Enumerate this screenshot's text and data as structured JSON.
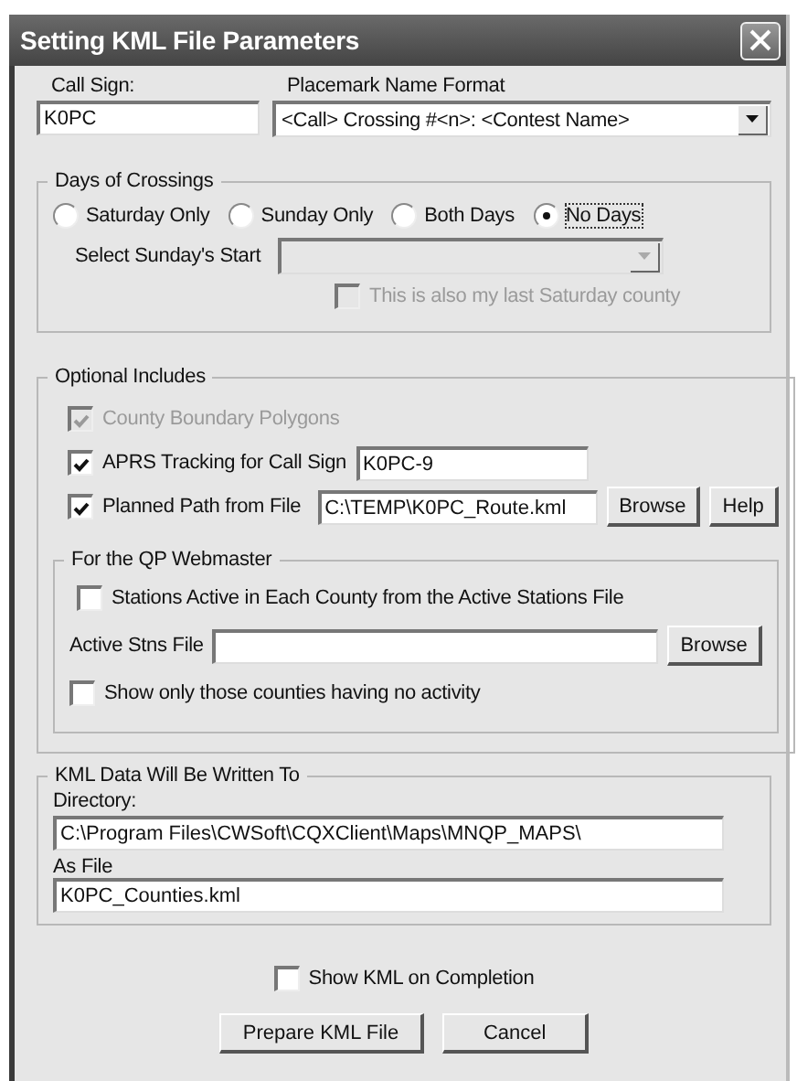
{
  "window": {
    "title": "Setting KML File Parameters"
  },
  "call_sign": {
    "label": "Call Sign:",
    "value": "K0PC"
  },
  "placemark_name_format": {
    "label": "Placemark Name Format",
    "value": "<Call> Crossing #<n>: <Contest Name>"
  },
  "days_of_crossings": {
    "title": "Days of Crossings",
    "options": [
      {
        "label": "Saturday Only",
        "selected": false
      },
      {
        "label": "Sunday Only",
        "selected": false
      },
      {
        "label": "Both Days",
        "selected": false
      },
      {
        "label": "No Days",
        "selected": true
      }
    ],
    "sunday_start": {
      "label": "Select Sunday's Start",
      "disabled": true
    },
    "last_saturday_county": {
      "label": "This is also my last Saturday county",
      "checked": false,
      "disabled": true
    }
  },
  "optional_includes": {
    "title": "Optional Includes",
    "items": [
      {
        "kind": "checkbox",
        "label": "County Boundary Polygons",
        "checked": true,
        "disabled": true
      },
      {
        "kind": "text",
        "label": "APRS Tracking for Call Sign",
        "checked": true,
        "disabled": false,
        "value": "K0PC-9"
      },
      {
        "kind": "file",
        "label": "Planned Path from File",
        "checked": true,
        "disabled": false,
        "value": "C:\\TEMP\\K0PC_Route.kml",
        "buttons": [
          "Browse",
          "Help"
        ]
      }
    ],
    "webmaster": {
      "title": "For the QP Webmaster",
      "stations_active": {
        "label": "Stations Active in Each County from the Active Stations File",
        "checked": false
      },
      "active_stns_file": {
        "label": "Active Stns File",
        "button": "Browse"
      },
      "no_activity": {
        "label": "Show only those counties having no activity",
        "checked": false
      }
    }
  },
  "output": {
    "title": "KML Data Will Be Written To",
    "directory": {
      "label": "Directory:",
      "value": "C:\\Program Files\\CWSoft\\CQXClient\\Maps\\MNQP_MAPS\\"
    },
    "file": {
      "label": "As File",
      "value": "K0PC_Counties.kml"
    }
  },
  "show_kml": {
    "label": "Show KML on Completion",
    "checked": false
  },
  "buttons": [
    "Prepare KML File",
    "Cancel"
  ]
}
